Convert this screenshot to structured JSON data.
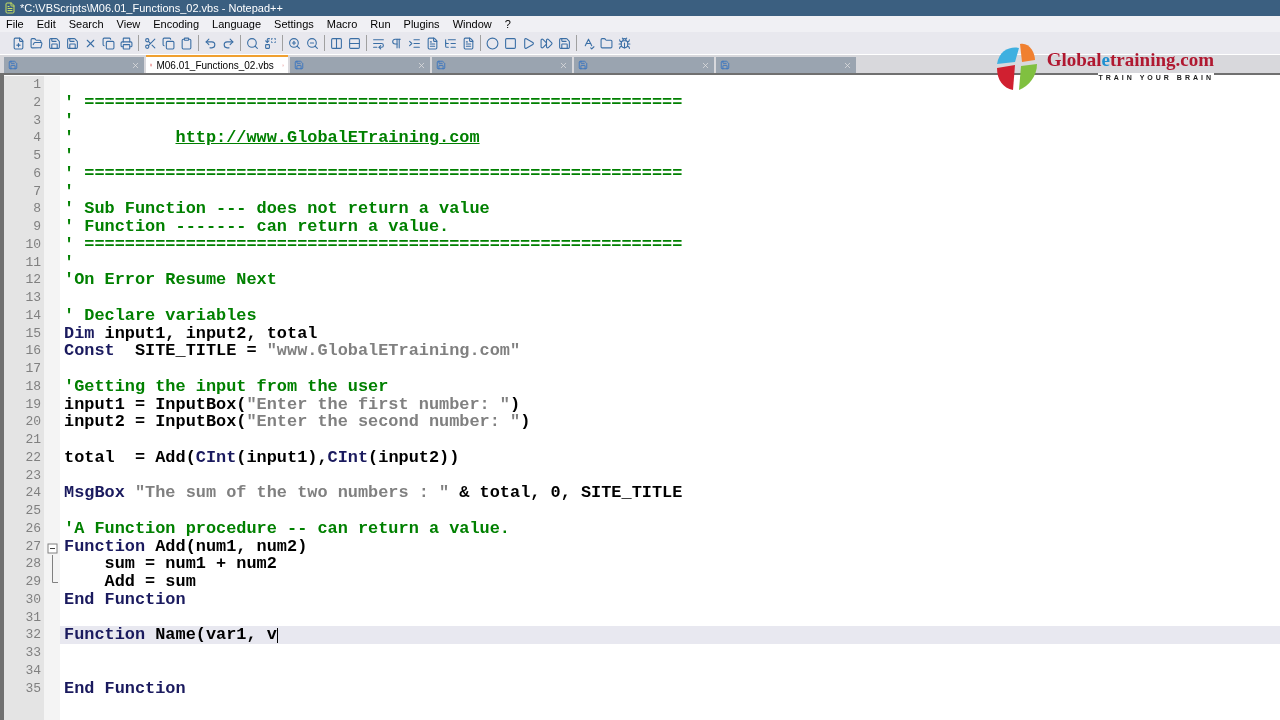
{
  "window": {
    "title": "*C:\\VBScripts\\M06.01_Functions_02.vbs - Notepad++"
  },
  "menu": [
    "File",
    "Edit",
    "Search",
    "View",
    "Encoding",
    "Language",
    "Settings",
    "Macro",
    "Run",
    "Plugins",
    "Window",
    "?"
  ],
  "tabs": [
    {
      "selected": false
    },
    {
      "label": "M06.01_Functions_02.vbs",
      "selected": true
    },
    {
      "selected": false
    },
    {
      "selected": false
    },
    {
      "selected": false
    },
    {
      "selected": false
    }
  ],
  "logo": {
    "start": "Global",
    "accent": "e",
    "end": "training.com",
    "tagline": "TRAIN YOUR BRAIN"
  },
  "editor": {
    "lines": [
      {
        "number": "1",
        "current": false
      },
      {
        "number": "2",
        "current": false,
        "tokens": [
          {
            "kind": "comment",
            "text": "' ==========================================================="
          }
        ]
      },
      {
        "number": "3",
        "current": false,
        "tokens": [
          {
            "kind": "comment",
            "text": "'"
          }
        ]
      },
      {
        "number": "4",
        "current": false,
        "tokens": [
          {
            "kind": "comment",
            "text": "'          "
          },
          {
            "kind": "link",
            "text": "http://www.GlobalETraining.com"
          }
        ]
      },
      {
        "number": "5",
        "current": false,
        "tokens": [
          {
            "kind": "comment",
            "text": "'"
          }
        ]
      },
      {
        "number": "6",
        "current": false,
        "tokens": [
          {
            "kind": "comment",
            "text": "' ==========================================================="
          }
        ]
      },
      {
        "number": "7",
        "current": false,
        "tokens": [
          {
            "kind": "comment",
            "text": "'"
          }
        ]
      },
      {
        "number": "8",
        "current": false,
        "tokens": [
          {
            "kind": "comment",
            "text": "' Sub Function --- does not return a value"
          }
        ]
      },
      {
        "number": "9",
        "current": false,
        "tokens": [
          {
            "kind": "comment",
            "text": "' Function ------- can return a value."
          }
        ]
      },
      {
        "number": "10",
        "current": false,
        "tokens": [
          {
            "kind": "comment",
            "text": "' ==========================================================="
          }
        ]
      },
      {
        "number": "11",
        "current": false,
        "tokens": [
          {
            "kind": "comment",
            "text": "'"
          }
        ]
      },
      {
        "number": "12",
        "current": false,
        "tokens": [
          {
            "kind": "comment",
            "text": "'On Error Resume Next"
          }
        ]
      },
      {
        "number": "13",
        "current": false
      },
      {
        "number": "14",
        "current": false,
        "tokens": [
          {
            "kind": "comment",
            "text": "' Declare variables"
          }
        ]
      },
      {
        "number": "15",
        "current": false,
        "tokens": [
          {
            "kind": "keyword",
            "text": "Dim"
          },
          {
            "kind": "plain",
            "text": " input1, input2, total"
          }
        ]
      },
      {
        "number": "16",
        "current": false,
        "tokens": [
          {
            "kind": "keyword",
            "text": "Const"
          },
          {
            "kind": "plain",
            "text": "  SITE_TITLE = "
          },
          {
            "kind": "string",
            "text": "\"www.GlobalETraining.com\""
          }
        ]
      },
      {
        "number": "17",
        "current": false
      },
      {
        "number": "18",
        "current": false,
        "tokens": [
          {
            "kind": "comment",
            "text": "'Getting the input from the user"
          }
        ]
      },
      {
        "number": "19",
        "current": false,
        "tokens": [
          {
            "kind": "plain",
            "text": "input1 = InputBox("
          },
          {
            "kind": "string",
            "text": "\"Enter the first number: \""
          },
          {
            "kind": "plain",
            "text": ")"
          }
        ]
      },
      {
        "number": "20",
        "current": false,
        "tokens": [
          {
            "kind": "plain",
            "text": "input2 = InputBox("
          },
          {
            "kind": "string",
            "text": "\"Enter the second number: \""
          },
          {
            "kind": "plain",
            "text": ")"
          }
        ]
      },
      {
        "number": "21",
        "current": false
      },
      {
        "number": "22",
        "current": false,
        "tokens": [
          {
            "kind": "plain",
            "text": "total  = Add("
          },
          {
            "kind": "keyword",
            "text": "CInt"
          },
          {
            "kind": "plain",
            "text": "(input1),"
          },
          {
            "kind": "keyword",
            "text": "CInt"
          },
          {
            "kind": "plain",
            "text": "(input2))"
          }
        ]
      },
      {
        "number": "23",
        "current": false
      },
      {
        "number": "24",
        "current": false,
        "tokens": [
          {
            "kind": "keyword",
            "text": "MsgBox"
          },
          {
            "kind": "string",
            "text": " \"The sum of the two numbers : \""
          },
          {
            "kind": "plain",
            "text": " & total, 0, SITE_TITLE"
          }
        ]
      },
      {
        "number": "25",
        "current": false
      },
      {
        "number": "26",
        "current": false,
        "tokens": [
          {
            "kind": "comment",
            "text": "'A Function procedure -- can return a value."
          }
        ]
      },
      {
        "number": "27",
        "current": false,
        "fold_expanded": true,
        "tokens": [
          {
            "kind": "keyword",
            "text": "Function"
          },
          {
            "kind": "plain",
            "text": " Add(num1, num2)"
          }
        ]
      },
      {
        "number": "28",
        "current": false,
        "in_fold": true,
        "tokens": [
          {
            "kind": "plain",
            "text": "    sum = num1 + num2"
          }
        ]
      },
      {
        "number": "29",
        "current": false,
        "in_fold": true,
        "tokens": [
          {
            "kind": "plain",
            "text": "    Add = sum"
          }
        ]
      },
      {
        "number": "30",
        "current": false,
        "tokens": [
          {
            "kind": "keyword",
            "text": "End Function"
          }
        ]
      },
      {
        "number": "31",
        "current": false
      },
      {
        "number": "32",
        "current": true,
        "tokens": [
          {
            "kind": "keyword",
            "text": "Function"
          },
          {
            "kind": "plain",
            "text": " Name(var1, v"
          }
        ]
      },
      {
        "number": "33",
        "current": false
      },
      {
        "number": "34",
        "current": false
      },
      {
        "number": "35",
        "current": false,
        "tokens": [
          {
            "kind": "keyword",
            "text": "End Function"
          }
        ]
      }
    ]
  }
}
